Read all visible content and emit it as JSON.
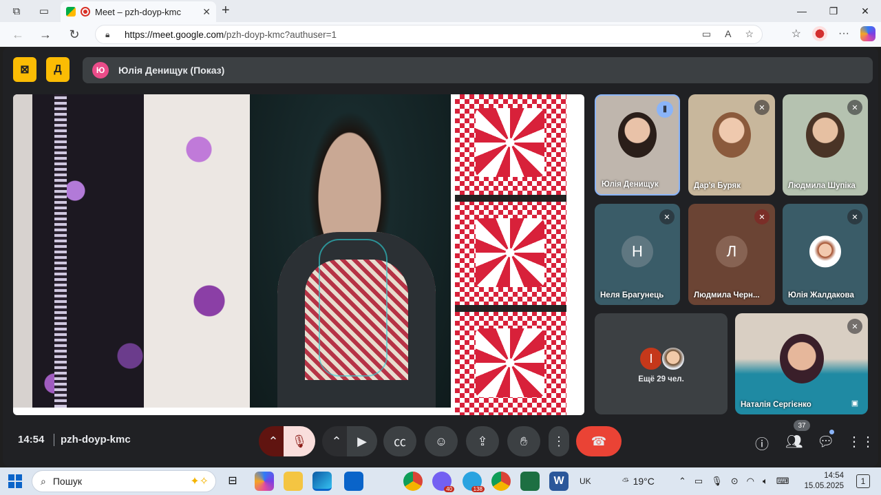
{
  "browser": {
    "tab_title": "Meet – pzh-doyp-kmc",
    "url_domain": "https://meet.google.com",
    "url_path": "/pzh-doyp-kmc?authuser=1"
  },
  "meet": {
    "presenter_initial": "Ю",
    "presenter_label": "Юлія Денищук (Показ)",
    "participants": [
      {
        "name": "Юлія Денищук"
      },
      {
        "name": "Дар'я Буряк"
      },
      {
        "name": "Людмила Шупіка"
      },
      {
        "name": "Неля Брагунець",
        "initial": "Н"
      },
      {
        "name": "Людмила Черн...",
        "initial": "Л"
      },
      {
        "name": "Юлія Жалдакова"
      },
      {
        "name": "Наталія Сергієнко"
      }
    ],
    "more_initial": "І",
    "more_label": "Ещё 29 чел.",
    "clock": "14:54",
    "meeting_code": "pzh-doyp-kmc",
    "participant_count": "37"
  },
  "taskbar": {
    "search_label": "Пошук",
    "lang": "UK",
    "weather": "19°C",
    "time": "14:54",
    "date": "15.05.2025",
    "badge_viber": "40",
    "badge_telegram": "138",
    "notif_count": "1"
  },
  "colors": {
    "meet_bg": "#202124",
    "accent_yellow": "#fbbc04",
    "end_call": "#ea4335"
  }
}
